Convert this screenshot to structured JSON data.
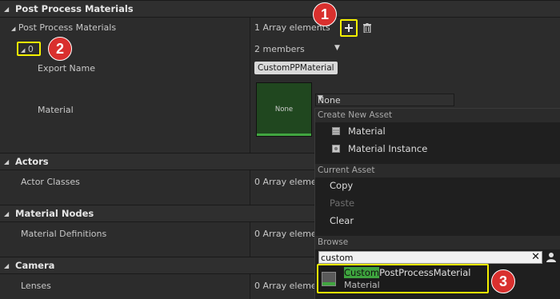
{
  "sections": {
    "post_process": "Post Process Materials",
    "actors": "Actors",
    "material_nodes": "Material Nodes",
    "camera": "Camera"
  },
  "rows": {
    "ppm_label": "Post Process Materials",
    "ppm_value": "1 Array elements",
    "index_label": "0",
    "index_value": "2 members",
    "export_name_label": "Export Name",
    "export_name_value": "CustomPPMaterial",
    "material_label": "Material",
    "material_thumb": "None",
    "material_combo": "None",
    "actor_classes_label": "Actor Classes",
    "actor_classes_value": "0 Array elements",
    "material_definitions_label": "Material Definitions",
    "material_definitions_value": "0 Array elements",
    "lenses_label": "Lenses",
    "lenses_value": "0 Array elements"
  },
  "menu": {
    "create_header": "Create New Asset",
    "create_items": [
      "Material",
      "Material Instance"
    ],
    "current_header": "Current Asset",
    "copy": "Copy",
    "paste": "Paste",
    "clear": "Clear",
    "browse_header": "Browse",
    "search_value": "custom",
    "result_match": "Custom",
    "result_rest": "PostProcessMaterial",
    "result_type": "Material"
  },
  "badges": [
    "1",
    "2",
    "3"
  ],
  "icons": {
    "add": "plus-icon",
    "delete": "trash-icon",
    "clear_search": "close-icon",
    "user": "user-icon"
  },
  "colors": {
    "highlight": "#f4f000",
    "badge": "#d9302e",
    "match": "#3ea33e"
  }
}
